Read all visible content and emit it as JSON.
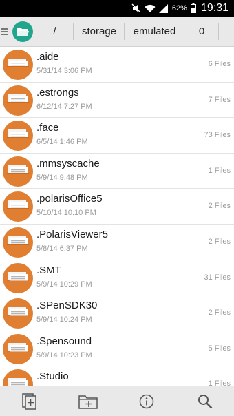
{
  "status_bar": {
    "battery": "62%",
    "time": "19:31"
  },
  "path": {
    "root": "/",
    "segments": [
      "storage",
      "emulated",
      "0"
    ]
  },
  "files": [
    {
      "name": ".aide",
      "date": "5/31/14 3:06 PM",
      "count": "6 Files"
    },
    {
      "name": ".estrongs",
      "date": "6/12/14 7:27 PM",
      "count": "7 Files"
    },
    {
      "name": ".face",
      "date": "6/5/14 1:46 PM",
      "count": "73 Files"
    },
    {
      "name": ".mmsyscache",
      "date": "5/9/14 9:48 PM",
      "count": "1 Files"
    },
    {
      "name": ".polarisOffice5",
      "date": "5/10/14 10:10 PM",
      "count": "2 Files"
    },
    {
      "name": ".PolarisViewer5",
      "date": "5/8/14 6:37 PM",
      "count": "2 Files"
    },
    {
      "name": ".SMT",
      "date": "5/9/14 10:29 PM",
      "count": "31 Files"
    },
    {
      "name": ".SPenSDK30",
      "date": "5/9/14 10:24 PM",
      "count": "2 Files"
    },
    {
      "name": ".Spensound",
      "date": "5/9/14 10:23 PM",
      "count": "5 Files"
    },
    {
      "name": ".Studio",
      "date": "",
      "count": "1 Files"
    }
  ],
  "toolbar": {
    "icons": [
      "new-file-icon",
      "new-folder-icon",
      "info-icon",
      "search-icon"
    ]
  },
  "colors": {
    "folder": "#e07f32",
    "app_logo": "#21a68d",
    "bar_bg": "#e9e9e9"
  }
}
